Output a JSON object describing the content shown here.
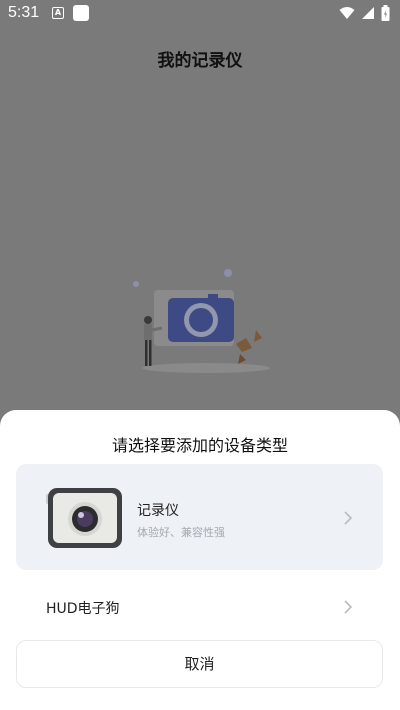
{
  "status_bar": {
    "time": "5:31",
    "notification_letter": "A"
  },
  "page": {
    "title": "我的记录仪"
  },
  "sheet": {
    "title": "请选择要添加的设备类型",
    "options": [
      {
        "label": "记录仪",
        "subtitle": "体验好、兼容性强",
        "icon": "dashcam-icon"
      },
      {
        "label": "HUD电子狗"
      }
    ],
    "cancel_label": "取消"
  },
  "colors": {
    "scrim": "#7a7a7a",
    "card_bg": "#eef1f6",
    "camera_accent": "#4f5fa8"
  }
}
